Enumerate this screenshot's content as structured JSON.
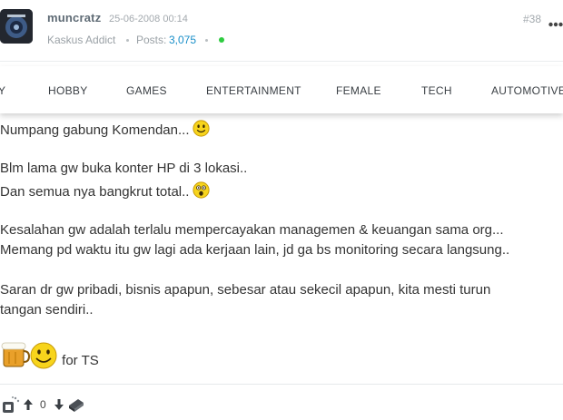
{
  "post": {
    "username": "muncratz",
    "date": "25-06-2008 00:14",
    "rank": "Kaskus Addict",
    "posts_label": "Posts:",
    "posts_count": "3,075",
    "number": "#38"
  },
  "categories": [
    "Y",
    "HOBBY",
    "GAMES",
    "ENTERTAINMENT",
    "FEMALE",
    "TECH",
    "AUTOMOTIVE"
  ],
  "body": {
    "line1": "Numpang gabung Komendan...",
    "line2": "Blm lama gw buka konter HP di 3 lokasi..",
    "line3": "Dan semua nya bangkrut total..",
    "line4": "Kesalahan gw adalah terlalu mempercayakan managemen & keuangan sama org...",
    "line5": "Memang pd waktu itu gw lagi ada kerjaan lain, jd ga bs monitoring secara langsung..",
    "line6": "Saran dr gw pribadi, bisnis apapun, sebesar atau sekecil apapun, kita mesti turun",
    "line7": "tangan sendiri..",
    "line8": "for TS"
  },
  "footer": {
    "vote_count": "0"
  },
  "icons": {
    "more": "more-dots-icon",
    "smile": "smile-emoji-icon",
    "shocked": "shocked-emoji-icon",
    "cendol": "cendol-beer-emoji-icon",
    "upvote": "arrow-up-icon",
    "downvote": "arrow-down-icon"
  },
  "colors": {
    "accent_link": "#1a8fc9",
    "online": "#2ecc40"
  }
}
